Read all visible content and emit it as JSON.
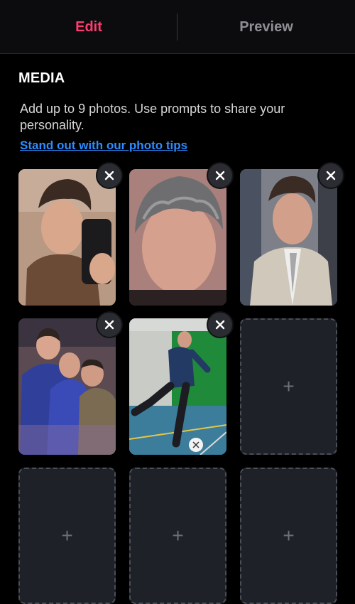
{
  "tabs": {
    "edit_label": "Edit",
    "preview_label": "Preview",
    "active": "edit",
    "active_color": "#fe3c72"
  },
  "media": {
    "title": "MEDIA",
    "description": "Add up to 9 photos. Use prompts to share your personality.",
    "tips_link": "Stand out with our photo tips",
    "max_photos": 9,
    "photos": [
      {
        "slot": 1,
        "filled": true,
        "depicts": "selfie-mirror"
      },
      {
        "slot": 2,
        "filled": true,
        "depicts": "closeup-portrait"
      },
      {
        "slot": 3,
        "filled": true,
        "depicts": "suit-portrait"
      },
      {
        "slot": 4,
        "filled": true,
        "depicts": "group-photo"
      },
      {
        "slot": 5,
        "filled": true,
        "depicts": "football-action"
      },
      {
        "slot": 6,
        "filled": false,
        "add_glyph": "+"
      },
      {
        "slot": 7,
        "filled": false,
        "add_glyph": "+"
      },
      {
        "slot": 8,
        "filled": false,
        "add_glyph": "+"
      },
      {
        "slot": 9,
        "filled": false,
        "add_glyph": "+"
      }
    ]
  },
  "icons": {
    "remove": "close-icon",
    "add": "plus-icon"
  },
  "colors": {
    "link": "#2d8cff",
    "background": "#000000",
    "empty_slot": "#1e2128"
  }
}
